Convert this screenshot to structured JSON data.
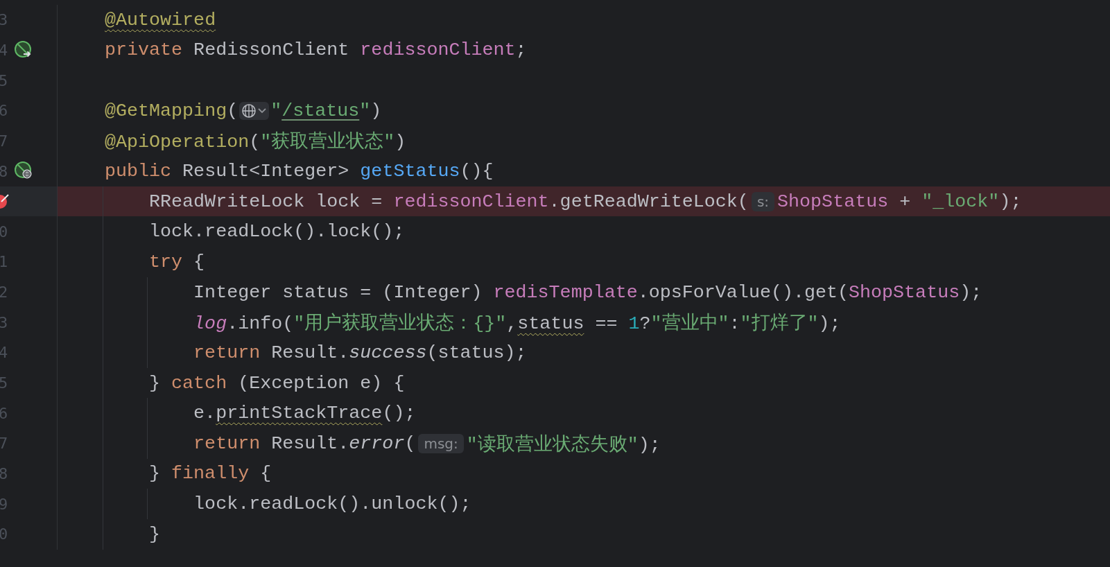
{
  "editor": {
    "lines": [
      {
        "number": "3",
        "breakpoint": false,
        "segments": [
          {
            "kind": "code",
            "tokens": [
              {
                "kind": "annotation",
                "text": "@Autowired",
                "underline": {
                  "kind": "wavy"
                }
              }
            ]
          }
        ]
      },
      {
        "number": "4",
        "breakpoint": false,
        "gutter_icon": {
          "kind": "bean-arrow"
        },
        "segments": [
          {
            "kind": "code",
            "tokens": [
              {
                "kind": "keyword",
                "text": "private"
              },
              {
                "kind": "plain",
                "text": " RedissonClient "
              },
              {
                "kind": "field",
                "text": "redissonClient"
              },
              {
                "kind": "plain",
                "text": ";"
              }
            ]
          }
        ]
      },
      {
        "number": "5",
        "breakpoint": false
      },
      {
        "number": "6",
        "breakpoint": false,
        "segments": [
          {
            "kind": "code",
            "tokens": [
              {
                "kind": "annotation",
                "text": "@GetMapping"
              },
              {
                "kind": "plain",
                "text": "("
              }
            ]
          },
          {
            "kind": "url-inlay"
          },
          {
            "kind": "code",
            "tokens": [
              {
                "kind": "string",
                "text": "\""
              },
              {
                "kind": "string",
                "text": "/status",
                "underline": {
                  "kind": "link"
                }
              },
              {
                "kind": "string",
                "text": "\""
              },
              {
                "kind": "plain",
                "text": ")"
              }
            ]
          }
        ]
      },
      {
        "number": "7",
        "breakpoint": false,
        "segments": [
          {
            "kind": "code",
            "tokens": [
              {
                "kind": "annotation",
                "text": "@ApiOperation"
              },
              {
                "kind": "plain",
                "text": "("
              },
              {
                "kind": "string",
                "text": "\"获取营业状态\""
              },
              {
                "kind": "plain",
                "text": ")"
              }
            ]
          }
        ]
      },
      {
        "number": "8",
        "breakpoint": false,
        "gutter_icon": {
          "kind": "bean-globe"
        },
        "segments": [
          {
            "kind": "code",
            "tokens": [
              {
                "kind": "keyword",
                "text": "public"
              },
              {
                "kind": "plain",
                "text": " Result<Integer> "
              },
              {
                "kind": "method",
                "text": "getStatus"
              },
              {
                "kind": "plain",
                "text": "(){"
              }
            ]
          }
        ]
      },
      {
        "breakpoint": true,
        "segments": [
          {
            "kind": "code",
            "tokens": [
              {
                "kind": "plain",
                "text": "    RReadWriteLock lock = "
              },
              {
                "kind": "field",
                "text": "redissonClient"
              },
              {
                "kind": "plain",
                "text": ".getReadWriteLock("
              }
            ]
          },
          {
            "kind": "hint",
            "text": "s:"
          },
          {
            "kind": "code",
            "tokens": [
              {
                "kind": "field",
                "text": "ShopStatus"
              },
              {
                "kind": "plain",
                "text": " + "
              },
              {
                "kind": "string",
                "text": "\"_lock\""
              },
              {
                "kind": "plain",
                "text": ");"
              }
            ]
          }
        ]
      },
      {
        "number": "0",
        "breakpoint": false,
        "segments": [
          {
            "kind": "code",
            "tokens": [
              {
                "kind": "plain",
                "text": "    lock.readLock().lock();"
              }
            ]
          }
        ]
      },
      {
        "number": "1",
        "breakpoint": false,
        "segments": [
          {
            "kind": "code",
            "tokens": [
              {
                "kind": "keyword",
                "text": "    try"
              },
              {
                "kind": "plain",
                "text": " {"
              }
            ]
          }
        ]
      },
      {
        "number": "2",
        "breakpoint": false,
        "segments": [
          {
            "kind": "code",
            "tokens": [
              {
                "kind": "plain",
                "text": "        Integer status = (Integer) "
              },
              {
                "kind": "field",
                "text": "redisTemplate"
              },
              {
                "kind": "plain",
                "text": ".opsForValue().get("
              },
              {
                "kind": "field",
                "text": "ShopStatus"
              },
              {
                "kind": "plain",
                "text": ");"
              }
            ]
          }
        ]
      },
      {
        "number": "3",
        "breakpoint": false,
        "segments": [
          {
            "kind": "code",
            "tokens": [
              {
                "kind": "static-field",
                "text": "        log"
              },
              {
                "kind": "plain",
                "text": ".info("
              },
              {
                "kind": "string",
                "text": "\"用户获取营业状态：{}\""
              },
              {
                "kind": "plain",
                "text": ","
              },
              {
                "kind": "plain",
                "text": "status",
                "underline": {
                  "kind": "wavy"
                }
              },
              {
                "kind": "plain",
                "text": " == "
              },
              {
                "kind": "number",
                "text": "1"
              },
              {
                "kind": "plain",
                "text": "?"
              },
              {
                "kind": "string",
                "text": "\"营业中\""
              },
              {
                "kind": "plain",
                "text": ":"
              },
              {
                "kind": "string",
                "text": "\"打烊了\""
              },
              {
                "kind": "plain",
                "text": ");"
              }
            ]
          }
        ]
      },
      {
        "number": "4",
        "breakpoint": false,
        "segments": [
          {
            "kind": "code",
            "tokens": [
              {
                "kind": "keyword",
                "text": "        return"
              },
              {
                "kind": "plain",
                "text": " Result."
              },
              {
                "kind": "static-method",
                "text": "success"
              },
              {
                "kind": "plain",
                "text": "(status);"
              }
            ]
          }
        ]
      },
      {
        "number": "5",
        "breakpoint": false,
        "segments": [
          {
            "kind": "code",
            "tokens": [
              {
                "kind": "plain",
                "text": "    } "
              },
              {
                "kind": "keyword",
                "text": "catch"
              },
              {
                "kind": "plain",
                "text": " (Exception e) {"
              }
            ]
          }
        ]
      },
      {
        "number": "6",
        "breakpoint": false,
        "segments": [
          {
            "kind": "code",
            "tokens": [
              {
                "kind": "plain",
                "text": "        e."
              },
              {
                "kind": "plain",
                "text": "printStackTrace",
                "underline": {
                  "kind": "wavy"
                }
              },
              {
                "kind": "plain",
                "text": "();"
              }
            ]
          }
        ]
      },
      {
        "number": "7",
        "breakpoint": false,
        "segments": [
          {
            "kind": "code",
            "tokens": [
              {
                "kind": "keyword",
                "text": "        return"
              },
              {
                "kind": "plain",
                "text": " Result."
              },
              {
                "kind": "static-method",
                "text": "error"
              },
              {
                "kind": "plain",
                "text": "("
              }
            ]
          },
          {
            "kind": "hint",
            "text": "msg:"
          },
          {
            "kind": "code",
            "tokens": [
              {
                "kind": "string",
                "text": "\"读取营业状态失败\""
              },
              {
                "kind": "plain",
                "text": ");"
              }
            ]
          }
        ]
      },
      {
        "number": "8",
        "breakpoint": false,
        "segments": [
          {
            "kind": "code",
            "tokens": [
              {
                "kind": "plain",
                "text": "    } "
              },
              {
                "kind": "keyword",
                "text": "finally"
              },
              {
                "kind": "plain",
                "text": " {"
              }
            ]
          }
        ]
      },
      {
        "number": "9",
        "breakpoint": false,
        "segments": [
          {
            "kind": "code",
            "tokens": [
              {
                "kind": "plain",
                "text": "        lock.readLock().unlock();"
              }
            ]
          }
        ]
      },
      {
        "number": "0",
        "breakpoint": false,
        "segments": [
          {
            "kind": "code",
            "tokens": [
              {
                "kind": "plain",
                "text": "    }"
              }
            ]
          }
        ]
      }
    ]
  }
}
